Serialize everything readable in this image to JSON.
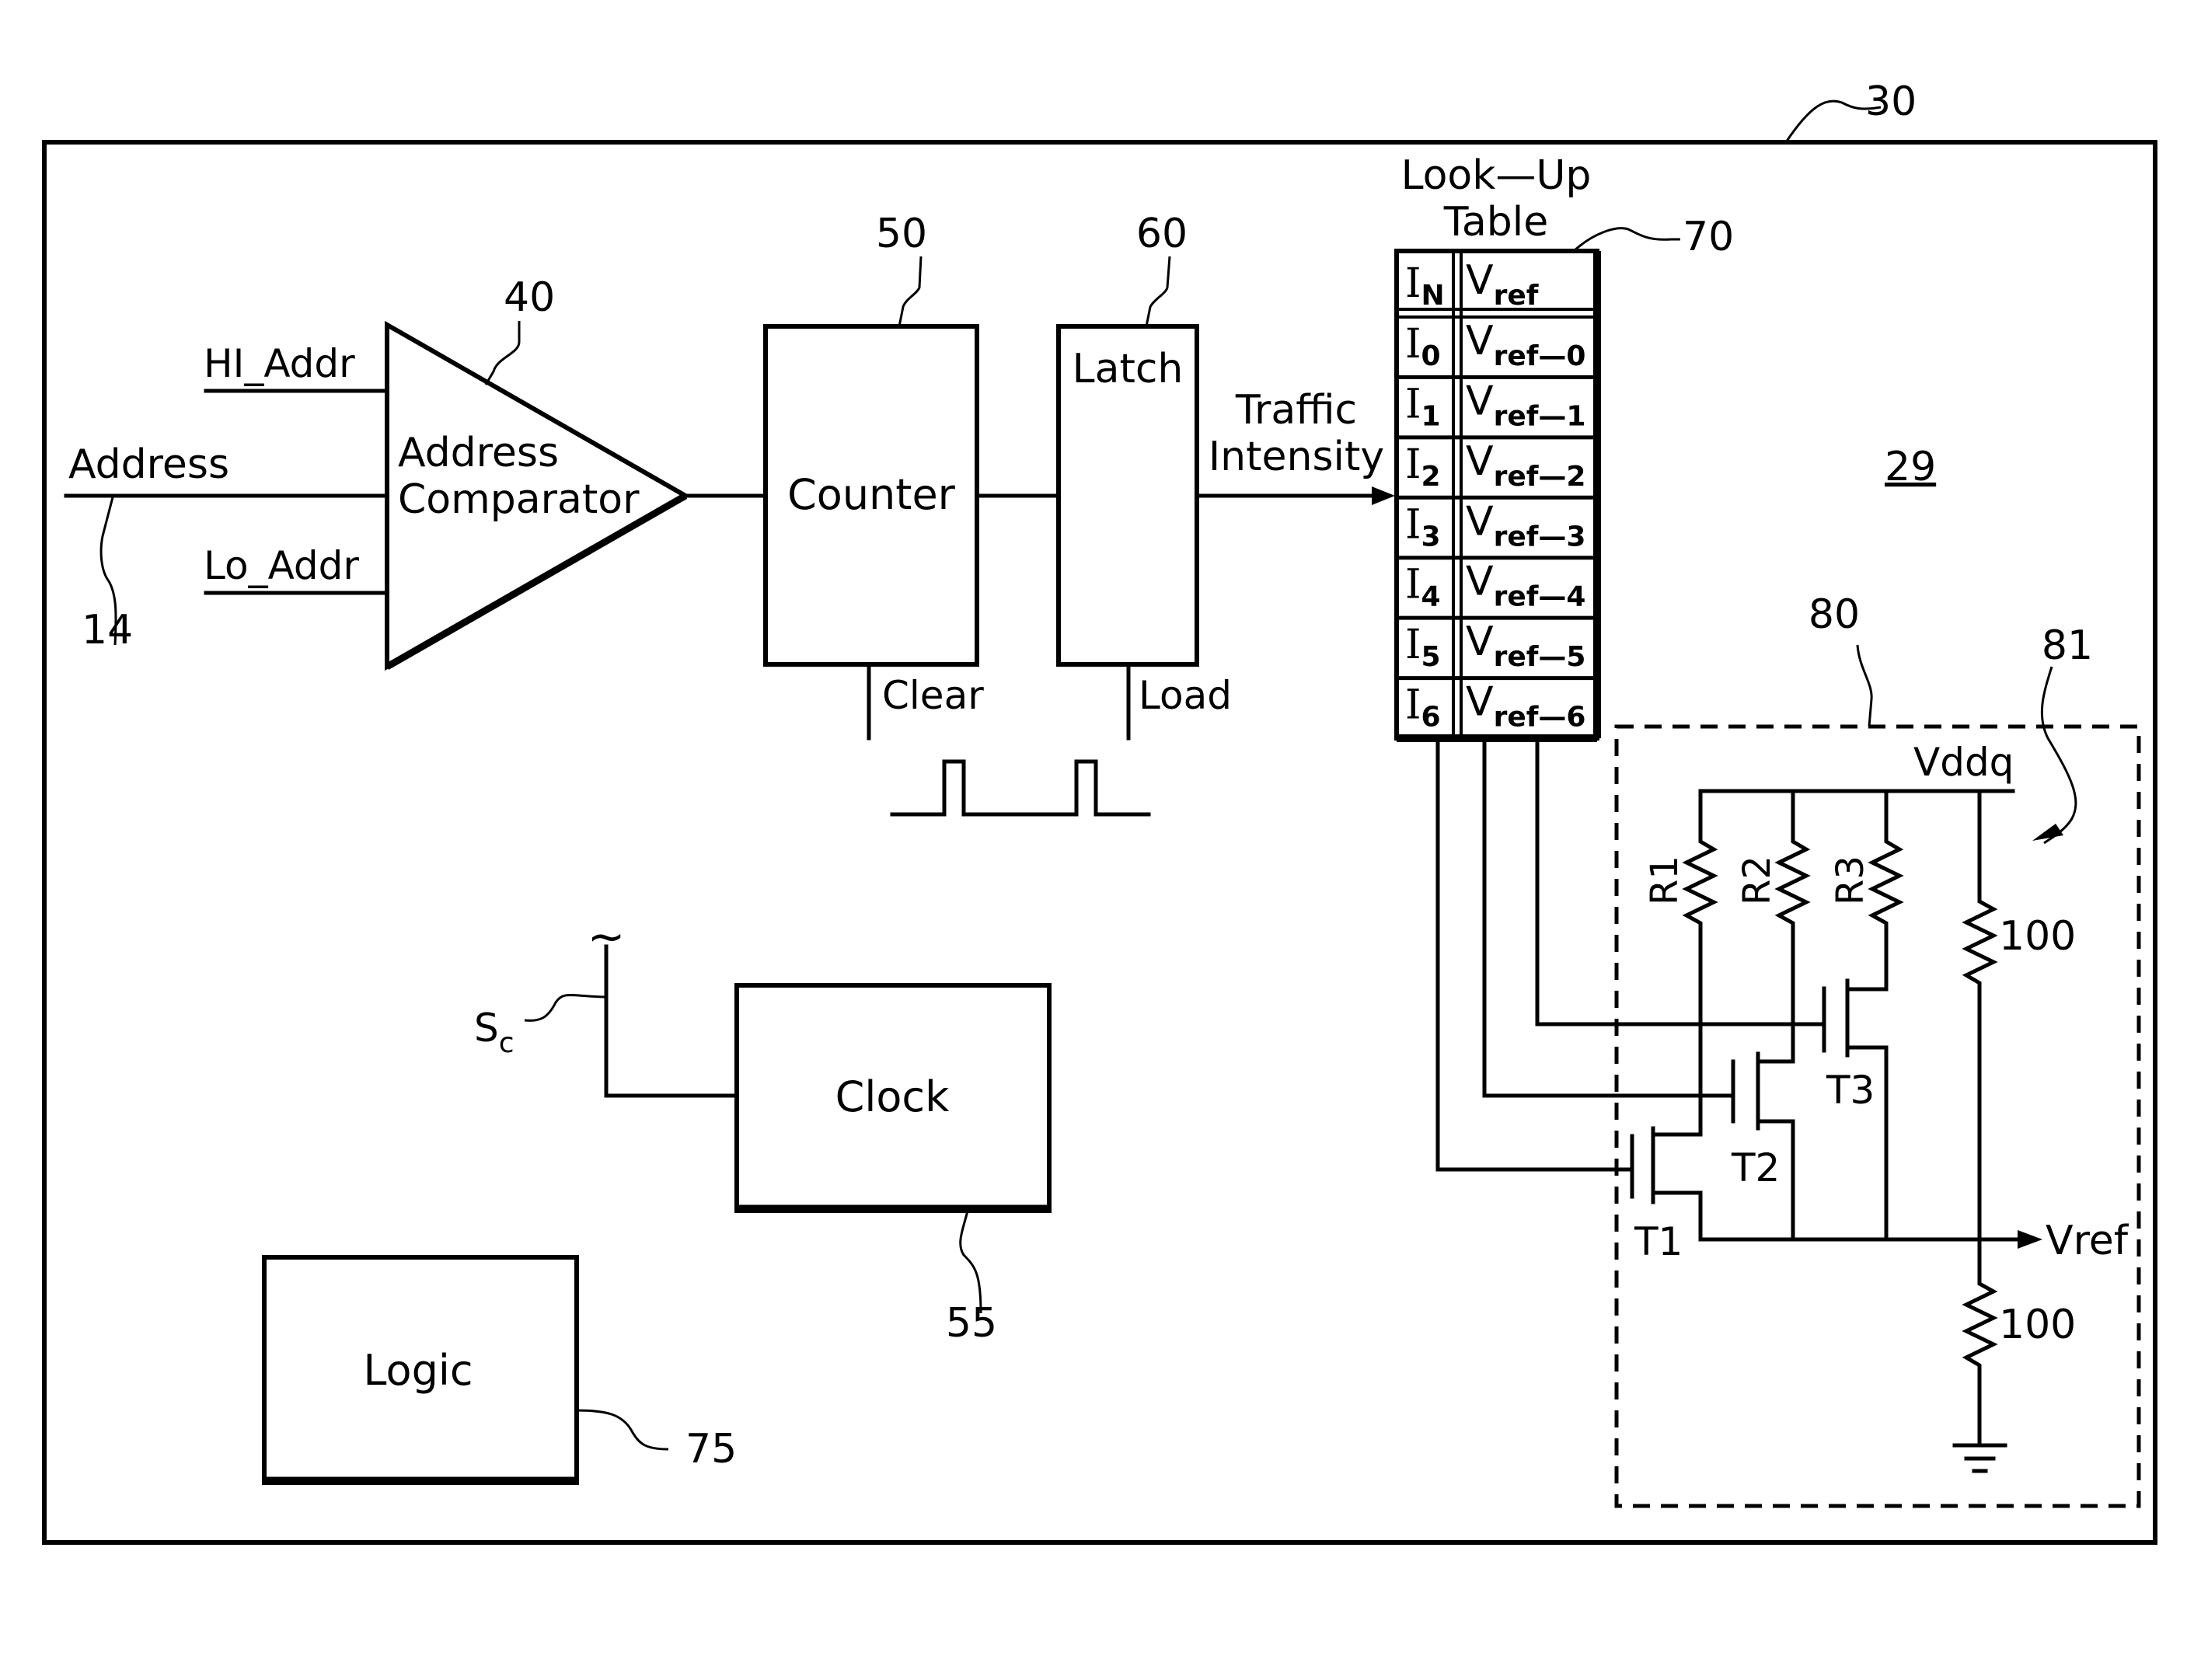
{
  "figure": {
    "frame_ref": "30",
    "chip_ref": "29"
  },
  "comparator": {
    "ref": "40",
    "label_line1": "Address",
    "label_line2": "Comparator",
    "inputs": {
      "hi": "HI_Addr",
      "address": "Address",
      "lo": "Lo_Addr"
    },
    "address_bus_ref": "14"
  },
  "counter": {
    "ref": "50",
    "label": "Counter",
    "control": "Clear"
  },
  "latch": {
    "ref": "60",
    "label": "Latch",
    "control": "Load"
  },
  "signal": {
    "line1": "Traffic",
    "line2": "Intensity"
  },
  "lookup_table": {
    "ref": "70",
    "title_line1": "Look—Up",
    "title_line2": "Table",
    "header": {
      "col1_main": "I",
      "col1_sub": "N",
      "col2_main": "V",
      "col2_sub": "ref"
    },
    "rows": [
      {
        "i_main": "I",
        "i_sub": "0",
        "v_main": "V",
        "v_sub": "ref—0"
      },
      {
        "i_main": "I",
        "i_sub": "1",
        "v_main": "V",
        "v_sub": "ref—1"
      },
      {
        "i_main": "I",
        "i_sub": "2",
        "v_main": "V",
        "v_sub": "ref—2"
      },
      {
        "i_main": "I",
        "i_sub": "3",
        "v_main": "V",
        "v_sub": "ref—3"
      },
      {
        "i_main": "I",
        "i_sub": "4",
        "v_main": "V",
        "v_sub": "ref—4"
      },
      {
        "i_main": "I",
        "i_sub": "5",
        "v_main": "V",
        "v_sub": "ref—5"
      },
      {
        "i_main": "I",
        "i_sub": "6",
        "v_main": "V",
        "v_sub": "ref—6"
      }
    ]
  },
  "clock": {
    "ref": "55",
    "label": "Clock",
    "signal_main": "S",
    "signal_sub": "c",
    "source_symbol": "~"
  },
  "logic": {
    "ref": "75",
    "label": "Logic"
  },
  "vref_circuit": {
    "block_ref": "80",
    "divider_ref": "81",
    "supply": "Vddq",
    "output": "Vref",
    "resistors": [
      "R1",
      "R2",
      "R3"
    ],
    "transistors": [
      "T1",
      "T2",
      "T3"
    ],
    "divider_values": [
      "100",
      "100"
    ]
  }
}
